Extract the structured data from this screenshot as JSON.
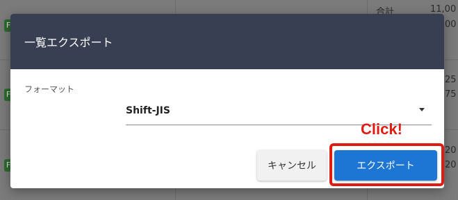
{
  "background": {
    "header_label": "合計",
    "header_value": "11,00",
    "row1_value_a": "00",
    "row2_value_a": "25",
    "row2_value_b": "75",
    "row3_value_a": "20",
    "row3_value_b": "20",
    "badge": "F"
  },
  "dialog": {
    "title": "一覧エクスポート",
    "format_label": "フォーマット",
    "format_value": "Shift-JIS",
    "cancel_label": "キャンセル",
    "export_label": "エクスポート"
  },
  "annotation": {
    "text": "Click!",
    "color": "#e01c12"
  },
  "colors": {
    "header_bg": "#393f52",
    "primary": "#1d76d4"
  }
}
